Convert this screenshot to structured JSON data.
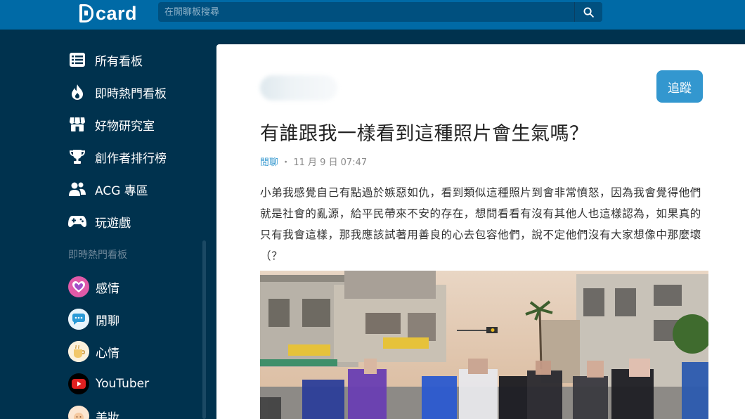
{
  "header": {
    "logo_text": "card",
    "search_placeholder": "在閒聊板搜尋",
    "brand_color": "#006aa6"
  },
  "sidebar": {
    "nav_items": [
      {
        "label": "所有看板",
        "icon": "list-icon"
      },
      {
        "label": "即時熱門看板",
        "icon": "fire-icon"
      },
      {
        "label": "好物研究室",
        "icon": "store-icon"
      },
      {
        "label": "創作者排行榜",
        "icon": "trophy-icon"
      },
      {
        "label": "ACG 專區",
        "icon": "users-icon"
      },
      {
        "label": "玩遊戲",
        "icon": "gamepad-icon"
      }
    ],
    "section_title": "即時熱門看板",
    "boards": [
      {
        "label": "感情",
        "color": "#e05aa8"
      },
      {
        "label": "閒聊",
        "color": "#2a9ad6"
      },
      {
        "label": "心情",
        "color": "#f2c86a"
      },
      {
        "label": "YouTuber",
        "color": "#e02020"
      },
      {
        "label": "美妝",
        "color": "#f5c9a0"
      }
    ]
  },
  "post": {
    "follow_label": "追蹤",
    "title": "有誰跟我一樣看到這種照片會生氣嗎？",
    "board": "閒聊",
    "separator": "・",
    "date": "11 月 9 日 07:47",
    "body": "小弟我感覺自己有點過於嫉惡如仇，看到類似這種照片到會非常憤怒，因為我會覺得他們就是社會的亂源，給平民帶來不安的存在，想問看看有沒有其他人也這樣認為，如果真的只有我會這樣，那我應該試著用善良的心去包容他們，說不定他們沒有大家想像中那麼壞（？",
    "accent_color": "#3397cf"
  }
}
